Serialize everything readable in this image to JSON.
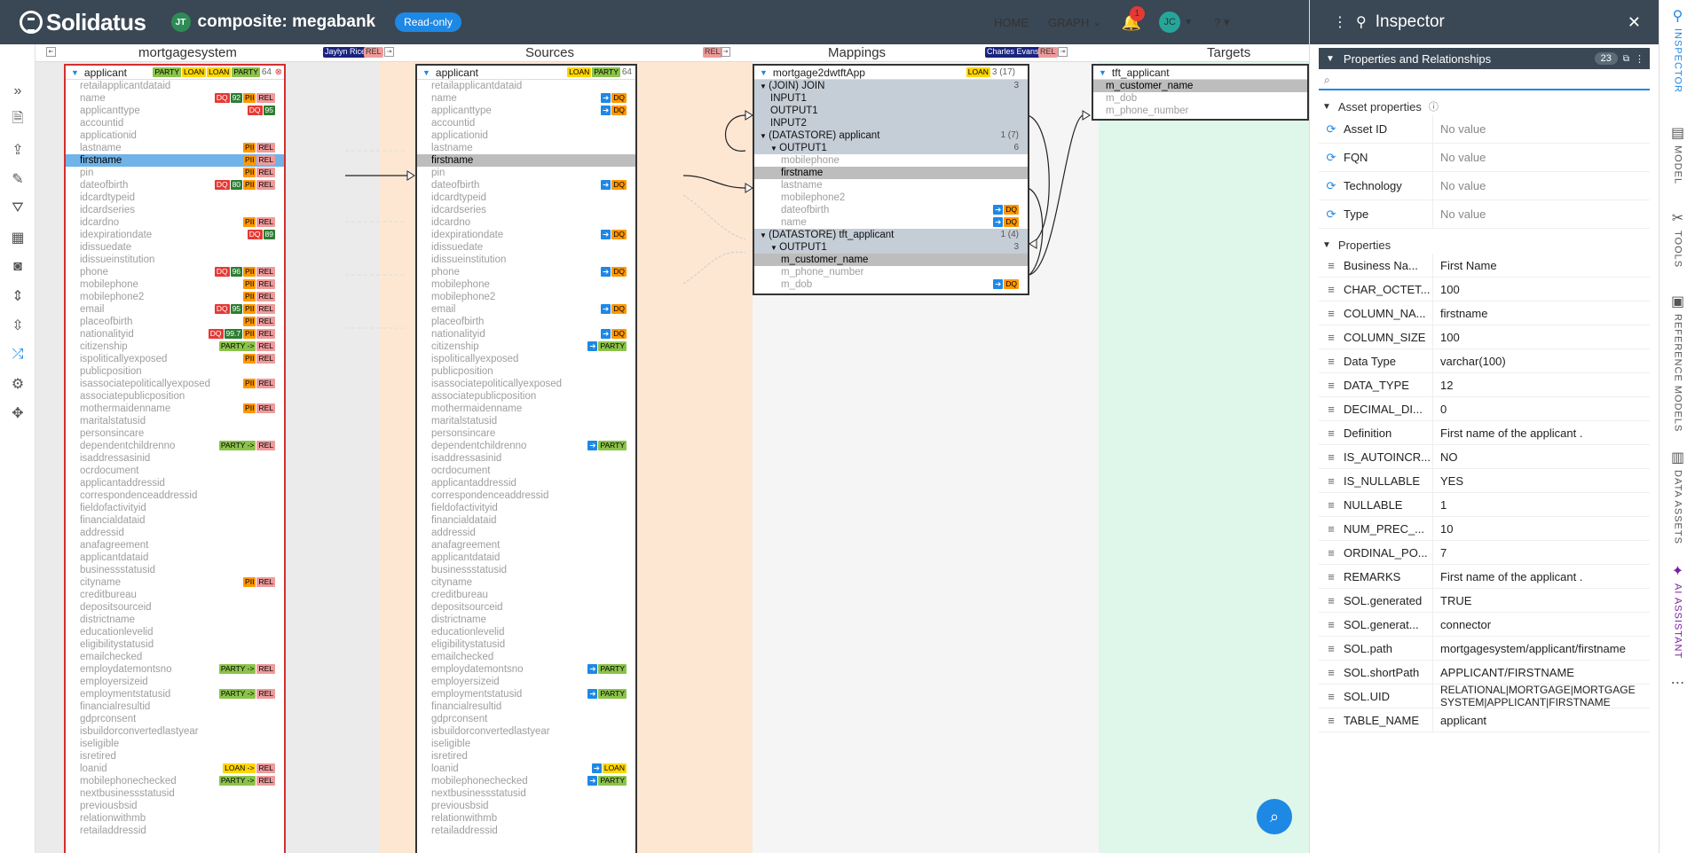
{
  "app": {
    "brand": "Solidatus",
    "workspace_initials": "JT",
    "title": "composite: megabank",
    "mode_badge": "Read-only"
  },
  "nav": {
    "home": "HOME",
    "graph": "GRAPH",
    "notifications": "1",
    "user_initials": "JC",
    "help": "?"
  },
  "columns": [
    {
      "label": "mortgagesystem",
      "owner": "Jaylyn Rice",
      "tag": "REL"
    },
    {
      "label": "Sources",
      "tag": "REL"
    },
    {
      "label": "Mappings",
      "owner": "Charles Evans",
      "tag": "REL"
    },
    {
      "label": "Targets"
    }
  ],
  "entity1": {
    "name": "applicant",
    "tags": [
      "PARTY",
      "LOAN",
      "LOAN",
      "PARTY"
    ],
    "count": "64",
    "rows": [
      {
        "n": "retailapplicantdataid",
        "t": []
      },
      {
        "n": "name",
        "t": [
          "DQ",
          "92",
          "PII",
          "REL"
        ]
      },
      {
        "n": "applicanttype",
        "t": [
          "DQ",
          "95"
        ]
      },
      {
        "n": "accountid",
        "t": []
      },
      {
        "n": "applicationid",
        "t": []
      },
      {
        "n": "lastname",
        "t": [
          "PII",
          "REL"
        ]
      },
      {
        "n": "firstname",
        "t": [
          "PII",
          "REL"
        ],
        "sel": true
      },
      {
        "n": "pin",
        "t": [
          "PII",
          "REL"
        ]
      },
      {
        "n": "dateofbirth",
        "t": [
          "DQ",
          "80",
          "PII",
          "REL"
        ]
      },
      {
        "n": "idcardtypeid",
        "t": []
      },
      {
        "n": "idcardseries",
        "t": []
      },
      {
        "n": "idcardno",
        "t": [
          "PII",
          "REL"
        ]
      },
      {
        "n": "idexpirationdate",
        "t": [
          "DQ",
          "89"
        ]
      },
      {
        "n": "idissuedate",
        "t": []
      },
      {
        "n": "idissueinstitution",
        "t": []
      },
      {
        "n": "phone",
        "t": [
          "DQ",
          "96",
          "PII",
          "REL"
        ]
      },
      {
        "n": "mobilephone",
        "t": [
          "PII",
          "REL"
        ]
      },
      {
        "n": "mobilephone2",
        "t": [
          "PII",
          "REL"
        ]
      },
      {
        "n": "email",
        "t": [
          "DQ",
          "95",
          "PII",
          "REL"
        ]
      },
      {
        "n": "placeofbirth",
        "t": [
          "PII",
          "REL"
        ]
      },
      {
        "n": "nationalityid",
        "t": [
          "DQ",
          "99.7",
          "PII",
          "REL"
        ]
      },
      {
        "n": "citizenship",
        "t": [
          "PARTY ->",
          "REL"
        ]
      },
      {
        "n": "ispoliticallyexposed",
        "t": [
          "PII",
          "REL"
        ]
      },
      {
        "n": "publicposition",
        "t": []
      },
      {
        "n": "isassociatepoliticallyexposed",
        "t": [
          "PII",
          "REL"
        ]
      },
      {
        "n": "associatepublicposition",
        "t": []
      },
      {
        "n": "mothermaidenname",
        "t": [
          "PII",
          "REL"
        ]
      },
      {
        "n": "maritalstatusid",
        "t": []
      },
      {
        "n": "personsincare",
        "t": []
      },
      {
        "n": "dependentchildrenno",
        "t": [
          "PARTY ->",
          "REL"
        ]
      },
      {
        "n": "isaddressasinid",
        "t": []
      },
      {
        "n": "ocrdocument",
        "t": []
      },
      {
        "n": "applicantaddressid",
        "t": []
      },
      {
        "n": "correspondenceaddressid",
        "t": []
      },
      {
        "n": "fieldofactivityid",
        "t": []
      },
      {
        "n": "financialdataid",
        "t": []
      },
      {
        "n": "addressid",
        "t": []
      },
      {
        "n": "anafagreement",
        "t": []
      },
      {
        "n": "applicantdataid",
        "t": []
      },
      {
        "n": "businessstatusid",
        "t": []
      },
      {
        "n": "cityname",
        "t": [
          "PII",
          "REL"
        ]
      },
      {
        "n": "creditbureau",
        "t": []
      },
      {
        "n": "depositsourceid",
        "t": []
      },
      {
        "n": "districtname",
        "t": []
      },
      {
        "n": "educationlevelid",
        "t": []
      },
      {
        "n": "eligibilitystatusid",
        "t": []
      },
      {
        "n": "emailchecked",
        "t": []
      },
      {
        "n": "employdatemontsno",
        "t": [
          "PARTY ->",
          "REL"
        ]
      },
      {
        "n": "employersizeid",
        "t": []
      },
      {
        "n": "employmentstatusid",
        "t": [
          "PARTY ->",
          "REL"
        ]
      },
      {
        "n": "financialresultid",
        "t": []
      },
      {
        "n": "gdprconsent",
        "t": []
      },
      {
        "n": "isbuildorconvertedlastyear",
        "t": []
      },
      {
        "n": "iseligible",
        "t": []
      },
      {
        "n": "isretired",
        "t": []
      },
      {
        "n": "loanid",
        "t": [
          "LOAN ->",
          "REL"
        ]
      },
      {
        "n": "mobilephonechecked",
        "t": [
          "PARTY ->",
          "REL"
        ]
      },
      {
        "n": "nextbusinessstatusid",
        "t": []
      },
      {
        "n": "previousbsid",
        "t": []
      },
      {
        "n": "relationwithmb",
        "t": []
      },
      {
        "n": "retailaddressid",
        "t": []
      }
    ]
  },
  "entity2": {
    "name": "applicant",
    "tags": [
      "LOAN",
      "PARTY"
    ],
    "count": "64",
    "tagmap": {
      "name": "DQ",
      "applicanttype": "DQ",
      "dateofbirth": "DQ",
      "idexpirationdate": "DQ",
      "phone": "DQ",
      "email": "DQ",
      "nationalityid": "DQ",
      "citizenship": "PARTY",
      "dependentchildrenno": "PARTY",
      "employdatemontsno": "PARTY",
      "employmentstatusid": "PARTY",
      "loanid": "LOAN",
      "mobilephonechecked": "PARTY"
    }
  },
  "mapping": {
    "name": "mortgage2dwtftApp",
    "tag": "LOAN",
    "count": "3 (17)",
    "rows": [
      {
        "n": "(JOIN) JOIN",
        "lvl": 0,
        "c": "3",
        "exp": true
      },
      {
        "n": "INPUT1",
        "lvl": 1,
        "c": ""
      },
      {
        "n": "OUTPUT1",
        "lvl": 1,
        "c": ""
      },
      {
        "n": "INPUT2",
        "lvl": 1,
        "c": ""
      },
      {
        "n": "(DATASTORE) applicant",
        "lvl": 0,
        "c": "1 (7)",
        "exp": true
      },
      {
        "n": "OUTPUT1",
        "lvl": 1,
        "c": "6",
        "exp": true
      },
      {
        "n": "mobilephone",
        "lvl": 2,
        "c": ""
      },
      {
        "n": "firstname",
        "lvl": 2,
        "c": "",
        "sel": true
      },
      {
        "n": "lastname",
        "lvl": 2,
        "c": ""
      },
      {
        "n": "mobilephone2",
        "lvl": 2,
        "c": ""
      },
      {
        "n": "dateofbirth",
        "lvl": 2,
        "c": "",
        "dq": true
      },
      {
        "n": "name",
        "lvl": 2,
        "c": "",
        "dq": true
      },
      {
        "n": "(DATASTORE) tft_applicant",
        "lvl": 0,
        "c": "1 (4)",
        "exp": true
      },
      {
        "n": "OUTPUT1",
        "lvl": 1,
        "c": "3",
        "exp": true
      },
      {
        "n": "m_customer_name",
        "lvl": 2,
        "c": "",
        "sel": true
      },
      {
        "n": "m_phone_number",
        "lvl": 2,
        "c": ""
      },
      {
        "n": "m_dob",
        "lvl": 2,
        "c": "",
        "dq": true
      }
    ]
  },
  "target": {
    "name": "tft_applicant",
    "rows": [
      {
        "n": "m_customer_name",
        "sel": true
      },
      {
        "n": "m_dob"
      },
      {
        "n": "m_phone_number"
      }
    ]
  },
  "inspector": {
    "title": "Inspector",
    "panel": "Properties and Relationships",
    "count": "23",
    "asset_section": "Asset properties",
    "asset_props": [
      {
        "k": "Asset ID",
        "v": "No value"
      },
      {
        "k": "FQN",
        "v": "No value"
      },
      {
        "k": "Technology",
        "v": "No value"
      },
      {
        "k": "Type",
        "v": "No value"
      }
    ],
    "props_section": "Properties",
    "props": [
      {
        "k": "Business Na...",
        "v": "First Name"
      },
      {
        "k": "CHAR_OCTET...",
        "v": "100"
      },
      {
        "k": "COLUMN_NA...",
        "v": "firstname"
      },
      {
        "k": "COLUMN_SIZE",
        "v": "100"
      },
      {
        "k": "Data Type",
        "v": "varchar(100)"
      },
      {
        "k": "DATA_TYPE",
        "v": "12"
      },
      {
        "k": "DECIMAL_DI...",
        "v": "0"
      },
      {
        "k": "Definition",
        "v": "First name of the applicant ."
      },
      {
        "k": "IS_AUTOINCR...",
        "v": "NO"
      },
      {
        "k": "IS_NULLABLE",
        "v": "YES"
      },
      {
        "k": "NULLABLE",
        "v": "1"
      },
      {
        "k": "NUM_PREC_...",
        "v": "10"
      },
      {
        "k": "ORDINAL_PO...",
        "v": "7"
      },
      {
        "k": "REMARKS",
        "v": "First name of the applicant ."
      },
      {
        "k": "SOL.generated",
        "v": "TRUE"
      },
      {
        "k": "SOL.generat...",
        "v": "connector"
      },
      {
        "k": "SOL.path",
        "v": "mortgagesystem/applicant/firstname"
      },
      {
        "k": "SOL.shortPath",
        "v": "APPLICANT/FIRSTNAME"
      },
      {
        "k": "SOL.UID",
        "v": "RELATIONAL|MORTGAGE|MORTGAGE SYSTEM|APPLICANT|FIRSTNAME"
      },
      {
        "k": "TABLE_NAME",
        "v": "applicant"
      }
    ]
  },
  "rail": [
    "INSPECTOR",
    "MODEL",
    "TOOLS",
    "REFERENCE MODELS",
    "DATA ASSETS",
    "AI ASSISTANT"
  ],
  "icons": {
    "fab": "search-icon"
  }
}
